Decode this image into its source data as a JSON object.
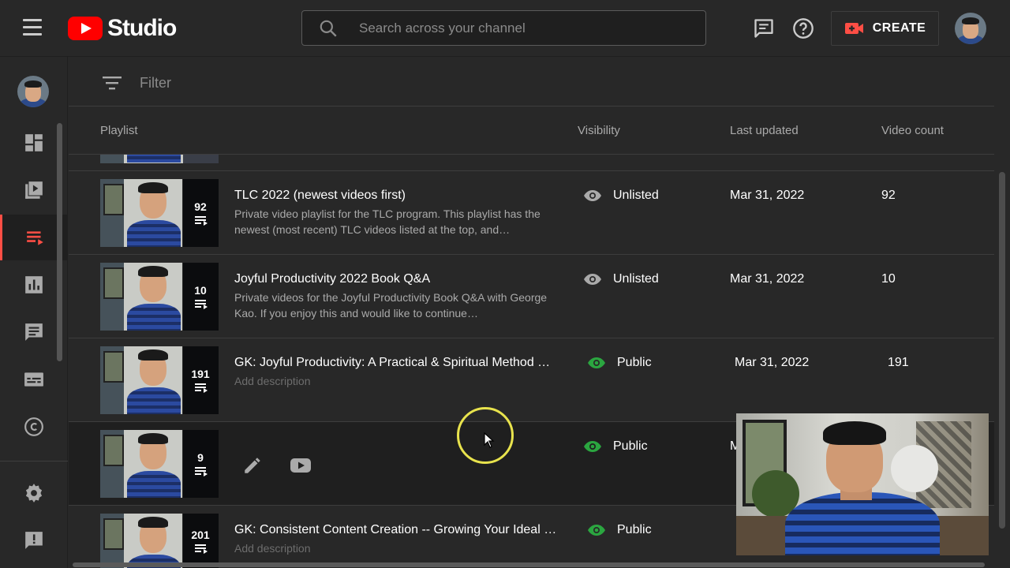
{
  "app": {
    "logo_text": "Studio",
    "accent": "#ff0000"
  },
  "header": {
    "search_placeholder": "Search across your channel",
    "create_label": "CREATE"
  },
  "sidebar": {
    "items": [
      {
        "name": "dashboard",
        "icon": "dashboard-icon"
      },
      {
        "name": "content",
        "icon": "video-library-icon"
      },
      {
        "name": "playlists",
        "icon": "playlist-icon",
        "active": true
      },
      {
        "name": "analytics",
        "icon": "analytics-icon"
      },
      {
        "name": "comments",
        "icon": "comments-icon"
      },
      {
        "name": "subtitles",
        "icon": "subtitles-icon"
      },
      {
        "name": "copyright",
        "icon": "copyright-icon"
      },
      {
        "name": "settings",
        "icon": "gear-icon"
      },
      {
        "name": "feedback",
        "icon": "feedback-icon"
      }
    ]
  },
  "filter": {
    "placeholder": "Filter"
  },
  "table": {
    "columns": {
      "playlist": "Playlist",
      "visibility": "Visibility",
      "updated": "Last updated",
      "count": "Video count"
    },
    "rows": [
      {
        "title": "TLC 2022 (newest videos first)",
        "description": "Private video playlist for the TLC program. This playlist has the newest (most recent) TLC videos listed at the top, and…",
        "visibility": "Unlisted",
        "updated": "Mar 31, 2022",
        "count": "92",
        "thumb_count": "92"
      },
      {
        "title": "Joyful Productivity 2022 Book Q&A",
        "description": "Private videos for the Joyful Productivity Book Q&A with George Kao. If you enjoy this and would like to continue…",
        "visibility": "Unlisted",
        "updated": "Mar 31, 2022",
        "count": "10",
        "thumb_count": "10"
      },
      {
        "title": "GK: Joyful Productivity: A Practical & Spiritual Method …",
        "description": "Add description",
        "visibility": "Public",
        "updated": "Mar 31, 2022",
        "count": "191",
        "thumb_count": "191"
      },
      {
        "title": "",
        "description": "",
        "visibility": "Public",
        "updated": "M",
        "count": "",
        "thumb_count": "9"
      },
      {
        "title": "GK: Consistent Content Creation -- Growing Your Ideal …",
        "description": "Add description",
        "visibility": "Public",
        "updated": "",
        "count": "",
        "thumb_count": "201"
      }
    ]
  },
  "colors": {
    "unlisted_icon": "#aaaaaa",
    "public_icon": "#2ba640",
    "active_nav": "#ff4e45"
  }
}
